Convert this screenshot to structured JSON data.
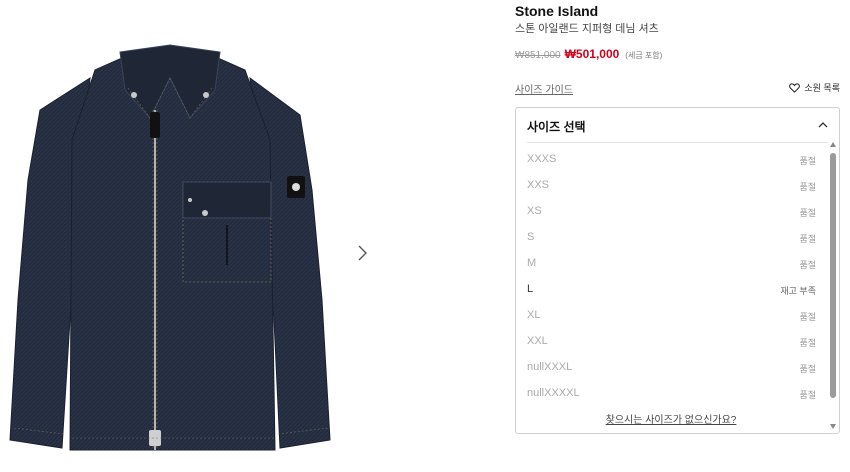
{
  "product": {
    "brand": "Stone Island",
    "name": "스톤 아일랜드 지퍼형 데님 셔츠",
    "original_price": "₩851,000",
    "sale_price": "₩501,000",
    "tax_note": "(세금 포함)"
  },
  "links": {
    "size_guide": "사이즈 가이드",
    "wishlist": "소원 목록",
    "size_not_found": "찾으시는 사이즈가 없으신가요?"
  },
  "size_dropdown": {
    "title": "사이즈 선택",
    "sizes": [
      {
        "size": "XXXS",
        "status": "품절"
      },
      {
        "size": "XXS",
        "status": "품절"
      },
      {
        "size": "XS",
        "status": "품절"
      },
      {
        "size": "S",
        "status": "품절"
      },
      {
        "size": "M",
        "status": "품절"
      },
      {
        "size": "L",
        "status": "재고 부족"
      },
      {
        "size": "XL",
        "status": "품절"
      },
      {
        "size": "XXL",
        "status": "품절"
      },
      {
        "size": "nullXXXL",
        "status": "품절"
      },
      {
        "size": "nullXXXXL",
        "status": "품절"
      }
    ]
  },
  "colors": {
    "sale_price": "#d0021b",
    "denim": "#232b3e"
  }
}
